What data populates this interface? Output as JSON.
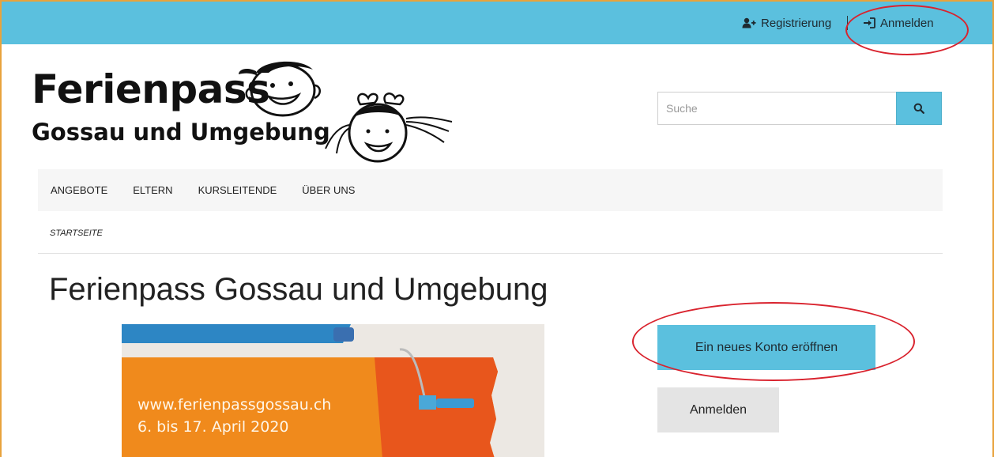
{
  "topbar": {
    "register_label": "Registrierung",
    "login_label": "Anmelden",
    "register_icon": "user-plus-icon",
    "login_icon": "sign-in-icon"
  },
  "logo": {
    "title": "Ferienpass",
    "subtitle": "Gossau und Umgebung"
  },
  "search": {
    "placeholder": "Suche",
    "button_icon": "search-icon"
  },
  "nav": {
    "items": [
      {
        "label": "ANGEBOTE"
      },
      {
        "label": "ELTERN"
      },
      {
        "label": "KURSLEITENDE"
      },
      {
        "label": "ÜBER UNS"
      }
    ]
  },
  "breadcrumb": {
    "current": "STARTSEITE"
  },
  "page": {
    "title": "Ferienpass Gossau und Umgebung"
  },
  "hero": {
    "url_text": "www.ferienpassgossau.ch",
    "date_text": "6. bis 17. April 2020"
  },
  "actions": {
    "new_account_label": "Ein neues Konto eröffnen",
    "login_label": "Anmelden"
  },
  "colors": {
    "accent": "#5bc0de",
    "frame": "#e8a33c",
    "annotation": "#d9232e",
    "hero_orange": "#f08a1c",
    "hero_blue": "#2d86c4"
  }
}
